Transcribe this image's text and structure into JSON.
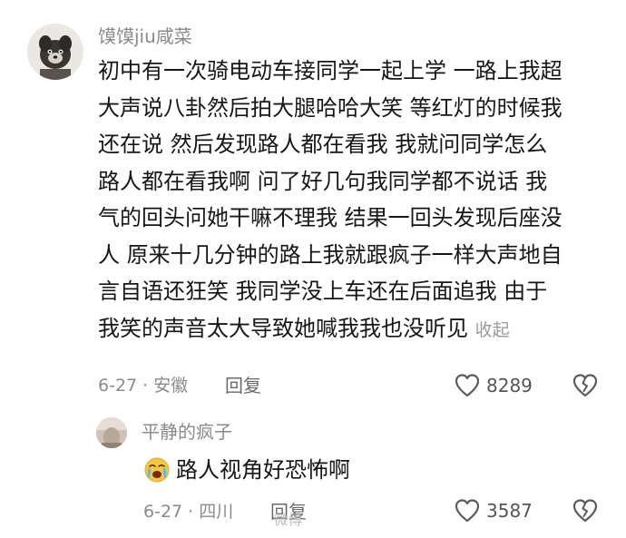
{
  "comment": {
    "username": "馍馍jiu咸菜",
    "text": "初中有一次骑电动车接同学一起上学 一路上我超\n大声说八卦然后拍大腿哈哈大笑 等红灯的时候我\n还在说 然后发现路人都在看我 我就问同学怎么\n路人都在看我啊 问了好几句我同学都不说话 我\n气的回头问她干嘛不理我 结果一回头发现后座没\n人 原来十几分钟的路上我就跟疯子一样大声地自\n言自语还狂笑 我同学没上车还在后面追我 由于\n我笑的声音太大导致她喊我我也没听见 ",
    "collapse_label": "收起",
    "date_location": "6-27 · 安徽",
    "reply_label": "回复",
    "like_count": "8289"
  },
  "reply": {
    "username": "平静的疯子",
    "emoji": "crying-face-icon",
    "text": "路人视角好恐怖啊",
    "date_location": "6-27 · 四川",
    "reply_label": "回复",
    "like_count": "3587"
  },
  "watermark": "微博"
}
